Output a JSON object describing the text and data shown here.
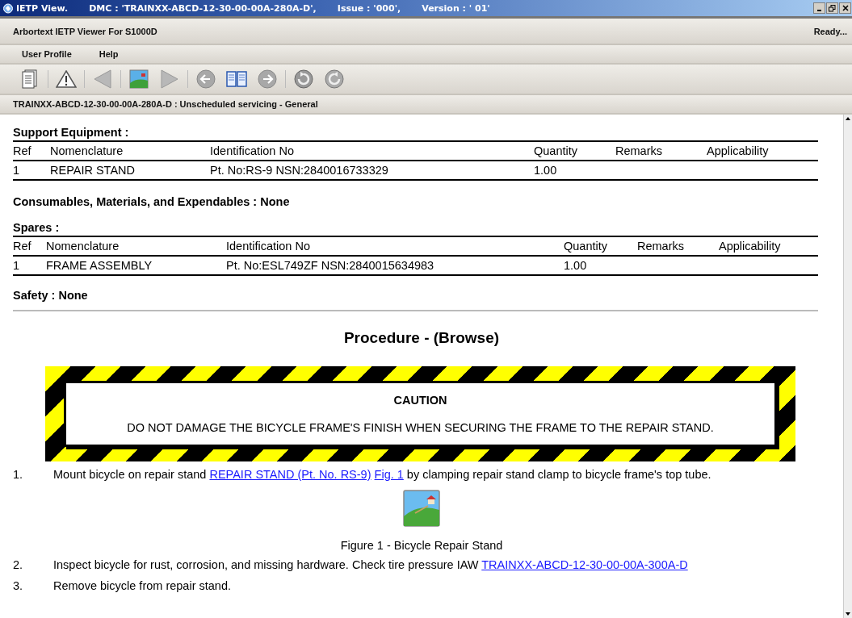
{
  "window": {
    "app_name": "IETP View.",
    "dmc": "DMC : 'TRAINXX-ABCD-12-30-00-00A-280A-D',",
    "issue": "Issue : '000',",
    "version": "Version : ' 01'"
  },
  "app_header": {
    "title": "Arbortext IETP Viewer For S1000D",
    "status": "Ready..."
  },
  "menu": [
    "User Profile",
    "Help"
  ],
  "toolbar": [
    {
      "kind": "document"
    },
    {
      "kind": "warning"
    },
    {
      "kind": "prev-triangle"
    },
    {
      "kind": "picture"
    },
    {
      "kind": "next-triangle"
    },
    {
      "kind": "back-circle"
    },
    {
      "kind": "book"
    },
    {
      "kind": "forward-circle"
    },
    {
      "kind": "refresh-left"
    },
    {
      "kind": "refresh-right"
    }
  ],
  "breadcrumb": "TRAINXX-ABCD-12-30-00-00A-280A-D : Unscheduled servicing - General",
  "support_equipment": {
    "heading": "Support Equipment :",
    "columns": [
      "Ref",
      "Nomenclature",
      "Identification No",
      "Quantity",
      "Remarks",
      "Applicability"
    ],
    "rows": [
      [
        "1",
        "REPAIR STAND",
        "Pt. No:RS-9 NSN:2840016733329",
        "1.00",
        "",
        ""
      ]
    ]
  },
  "consumables": "Consumables, Materials, and Expendables : None",
  "spares": {
    "heading": "Spares :",
    "columns": [
      "Ref",
      "Nomenclature",
      "Identification No",
      "Quantity",
      "Remarks",
      "Applicability"
    ],
    "rows": [
      [
        "1",
        "FRAME ASSEMBLY",
        "Pt. No:ESL749ZF NSN:2840015634983",
        "1.00",
        "",
        ""
      ]
    ]
  },
  "safety": "Safety : None",
  "procedure": {
    "title": "Procedure - (Browse)",
    "caution": {
      "title": "CAUTION",
      "text": "DO NOT DAMAGE THE BICYCLE FRAME'S FINISH WHEN SECURING THE FRAME TO THE REPAIR STAND."
    },
    "steps": [
      {
        "number": "1.",
        "parts": [
          {
            "kind": "text",
            "text": "Mount bicycle on repair stand "
          },
          {
            "kind": "link",
            "text": "REPAIR STAND (Pt. No. RS-9)"
          },
          {
            "kind": "link",
            "text": "Fig. 1"
          },
          {
            "kind": "text",
            "text": " by clamping repair stand clamp to bicycle frame's top tube."
          }
        ],
        "figure": {
          "caption": "Figure 1 - Bicycle Repair Stand"
        }
      },
      {
        "number": "2.",
        "parts": [
          {
            "kind": "text",
            "text": "Inspect bicycle for rust, corrosion, and missing hardware. Check tire pressure IAW "
          },
          {
            "kind": "link",
            "text": "TRAINXX-ABCD-12-30-00-00A-300A-D"
          }
        ]
      },
      {
        "number": "3.",
        "parts": [
          {
            "kind": "text",
            "text": "Remove bicycle from repair stand."
          }
        ]
      }
    ]
  }
}
